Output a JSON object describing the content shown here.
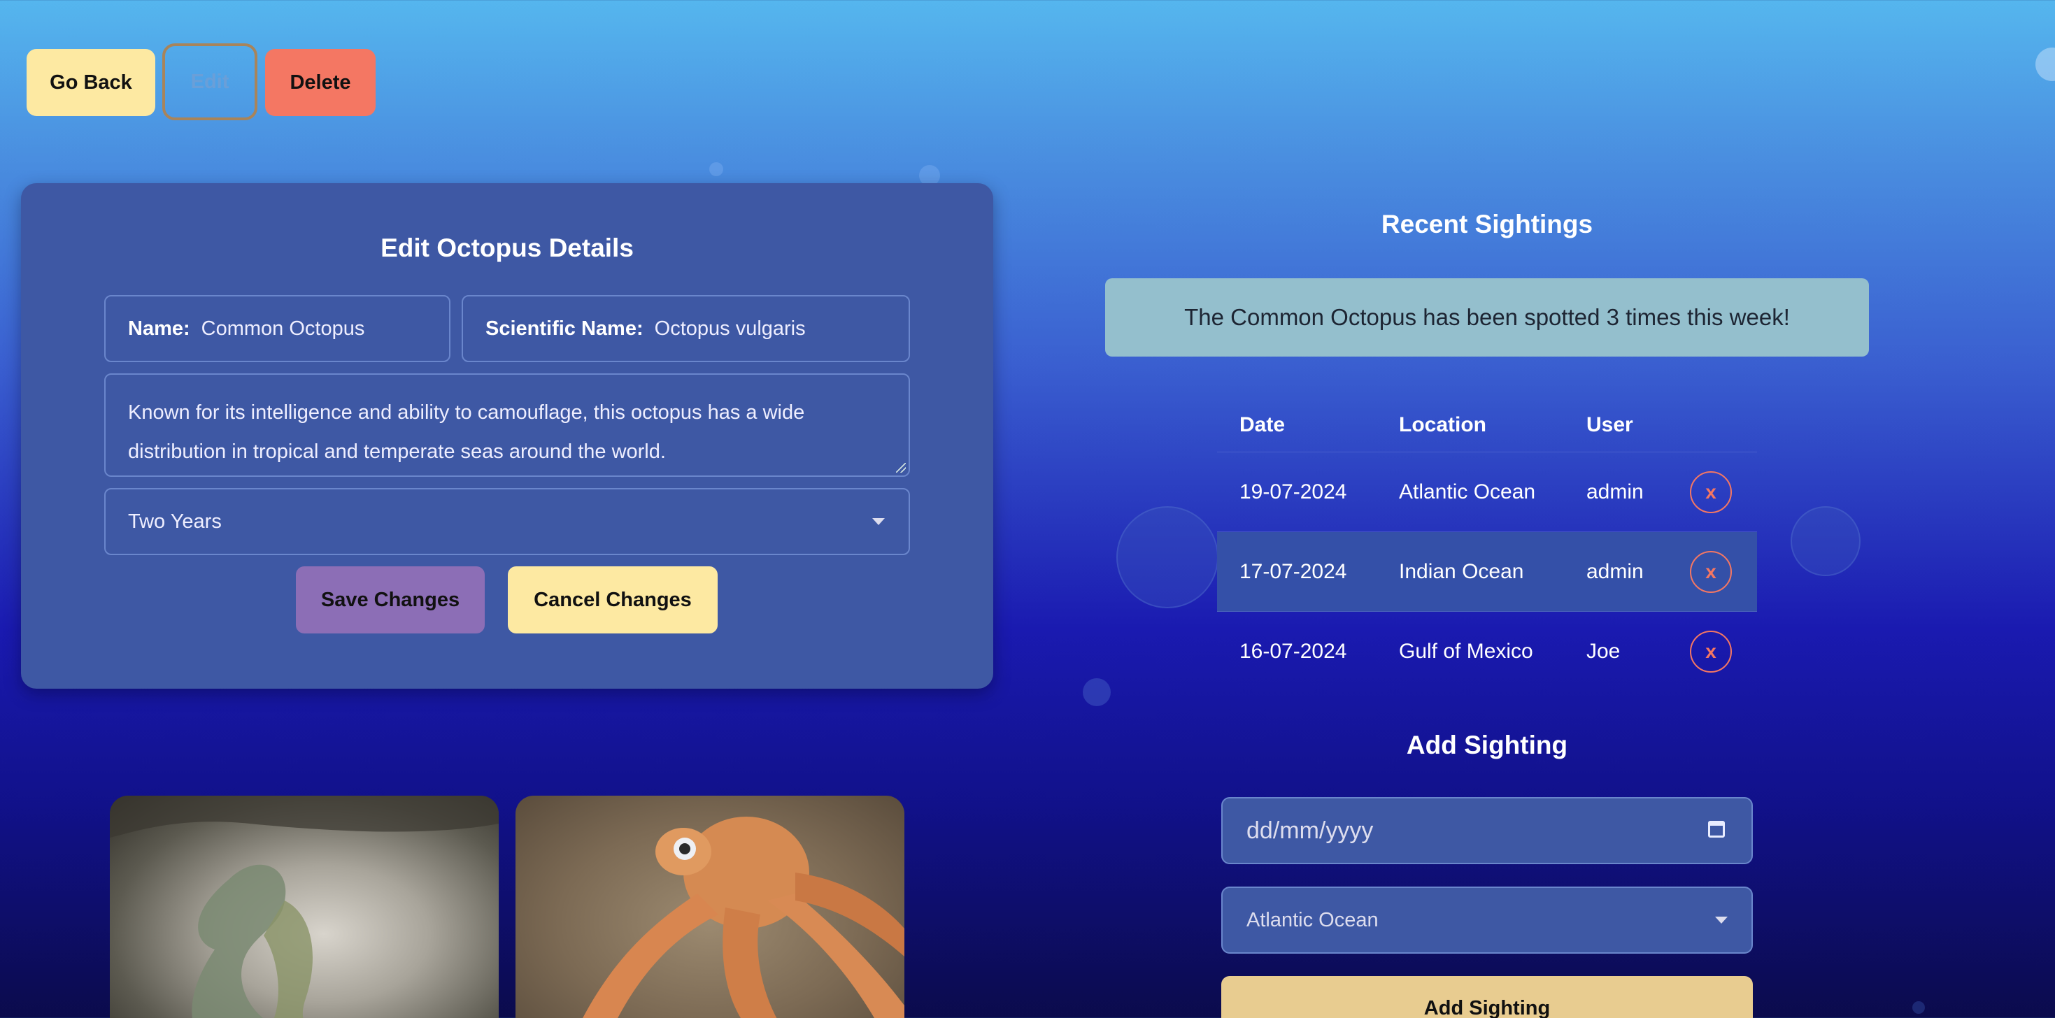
{
  "top_buttons": {
    "back": "Go Back",
    "edit": "Edit",
    "delete": "Delete"
  },
  "edit_panel": {
    "title": "Edit Octopus Details",
    "name_label": "Name:",
    "name_value": "Common Octopus",
    "sci_label": "Scientific Name:",
    "sci_value": "Octopus vulgaris",
    "description": "Known for its intelligence and ability to camouflage, this octopus has a wide distribution in tropical and temperate seas around the world.",
    "lifespan": "Two Years",
    "save": "Save Changes",
    "cancel": "Cancel Changes"
  },
  "sightings": {
    "title": "Recent Sightings",
    "banner": "The Common Octopus has been spotted 3 times this week!",
    "headers": {
      "date": "Date",
      "location": "Location",
      "user": "User"
    },
    "rows": [
      {
        "date": "19-07-2024",
        "location": "Atlantic Ocean",
        "user": "admin",
        "remove": "x"
      },
      {
        "date": "17-07-2024",
        "location": "Indian Ocean",
        "user": "admin",
        "remove": "x"
      },
      {
        "date": "16-07-2024",
        "location": "Gulf of Mexico",
        "user": "Joe",
        "remove": "x"
      }
    ]
  },
  "add_sighting": {
    "title": "Add Sighting",
    "date_placeholder": "dd/mm/yyyy",
    "location_value": "Atlantic Ocean",
    "button": "Add Sighting"
  },
  "colors": {
    "go_back": "#fde9a2",
    "delete": "#f47763",
    "save": "#8c6eb6",
    "panel": "#3e58a4",
    "banner": "#94bfcd"
  }
}
